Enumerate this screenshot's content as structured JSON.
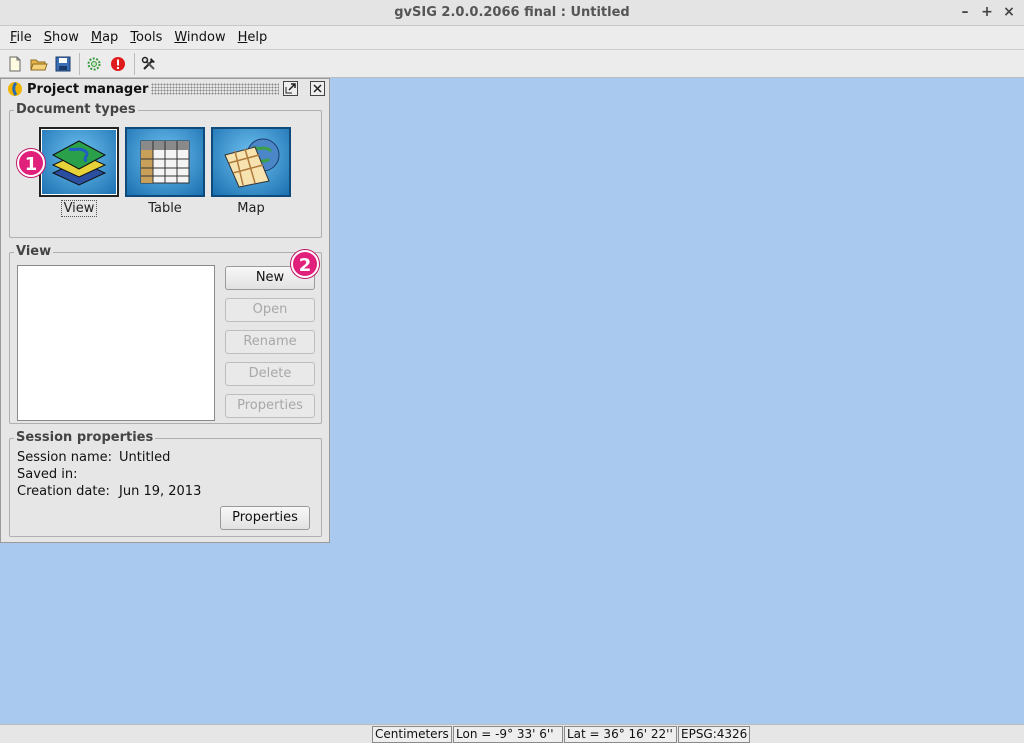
{
  "window": {
    "title": "gvSIG 2.0.0.2066 final : Untitled",
    "controls": [
      "–",
      "+",
      "×"
    ]
  },
  "menu": [
    {
      "key": "F",
      "rest": "ile"
    },
    {
      "key": "S",
      "rest": "how"
    },
    {
      "key": "M",
      "rest": "ap"
    },
    {
      "key": "T",
      "rest": "ools"
    },
    {
      "key": "W",
      "rest": "indow"
    },
    {
      "key": "H",
      "rest": "elp"
    }
  ],
  "toolbar": {
    "icons": [
      "new-project-icon",
      "open-project-icon",
      "save-project-icon",
      "preferences-gear-icon",
      "error-alert-icon",
      "tools-icon"
    ]
  },
  "project_manager": {
    "title": "Project manager",
    "document_types": {
      "legend": "Document types",
      "items": [
        {
          "label": "View",
          "icon": "view-layers-icon",
          "selected": true
        },
        {
          "label": "Table",
          "icon": "table-icon",
          "selected": false
        },
        {
          "label": "Map",
          "icon": "map-icon",
          "selected": false
        }
      ]
    },
    "documents": {
      "legend": "View",
      "buttons": {
        "new": "New",
        "open": "Open",
        "rename": "Rename",
        "delete": "Delete",
        "properties": "Properties"
      }
    },
    "session": {
      "legend": "Session properties",
      "name_label": "Session name:",
      "name_value": "Untitled",
      "saved_label": "Saved in:",
      "saved_value": "",
      "created_label": "Creation date:",
      "created_value": "Jun 19, 2013",
      "properties_button": "Properties"
    },
    "annotations": [
      "1",
      "2"
    ]
  },
  "statusbar": {
    "units": "Centimeters",
    "lon": "Lon = -9° 33' 6''",
    "lat": "Lat = 36° 16' 22''",
    "crs": "EPSG:4326"
  },
  "colors": {
    "desktop": "#a9c9ee",
    "badge": "#e0207a"
  }
}
